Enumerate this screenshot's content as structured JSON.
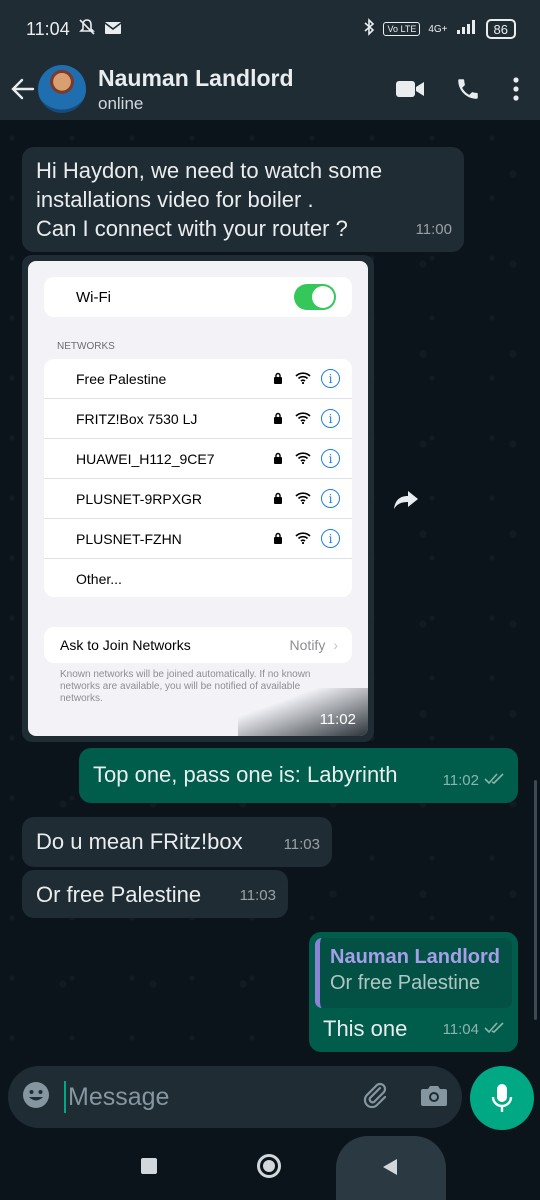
{
  "status": {
    "time": "11:04",
    "battery": "86",
    "net": "4G+",
    "volte": "Vo LTE"
  },
  "header": {
    "name": "Nauman Landlord",
    "status": "online"
  },
  "messages": {
    "m1": {
      "text": "Hi Haydon, we need to watch some installations video for boiler .\nCan I connect with your router ?",
      "time": "11:00"
    },
    "img": {
      "time": "11:02"
    },
    "m2": {
      "text": "Top one, pass one is: Labyrinth",
      "time": "11:02"
    },
    "m3": {
      "text": "Do u mean FRitz!box",
      "time": "11:03"
    },
    "m4": {
      "text": "Or free Palestine",
      "time": "11:03"
    },
    "m5": {
      "quote_author": "Nauman Landlord",
      "quote_text": "Or free Palestine",
      "text": "This one",
      "time": "11:04"
    }
  },
  "screenshot": {
    "wifi_label": "Wi-Fi",
    "networks_heading": "NETWORKS",
    "networks": [
      "Free Palestine",
      "FRITZ!Box 7530 LJ",
      "HUAWEI_H112_9CE7",
      "PLUSNET-9RPXGR",
      "PLUSNET-FZHN"
    ],
    "other": "Other...",
    "ask_label": "Ask to Join Networks",
    "ask_value": "Notify",
    "footnote": "Known networks will be joined automatically. If no known networks are available, you will be notified of available networks."
  },
  "input": {
    "placeholder": "Message"
  },
  "colors": {
    "accent": "#00a884",
    "outgoing": "#005c4b",
    "incoming": "#202c33",
    "ios_green": "#34c759",
    "ios_blue": "#1a7bf2"
  }
}
